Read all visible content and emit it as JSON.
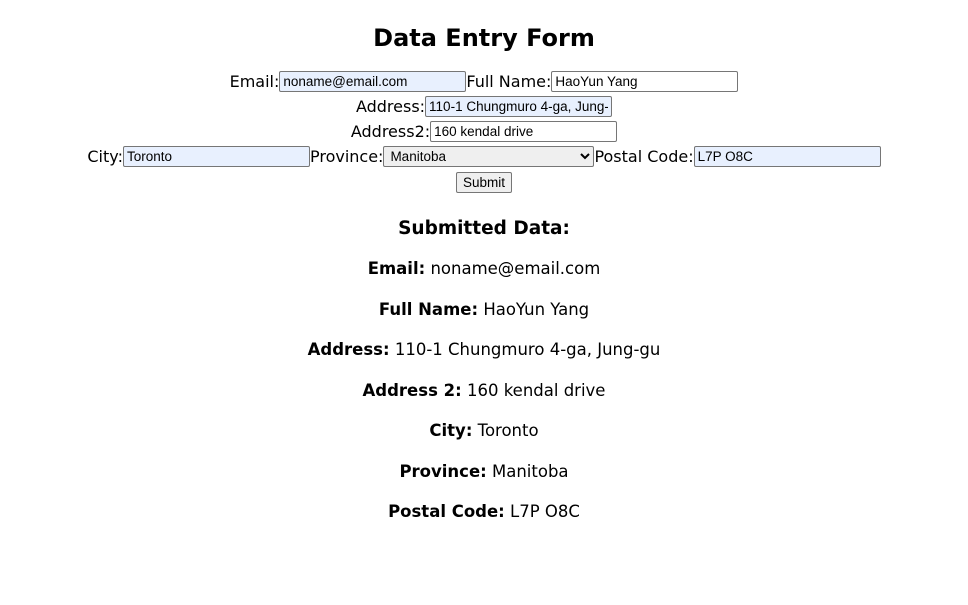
{
  "form": {
    "title": "Data Entry Form",
    "email_label": "Email:",
    "email_value": "noname@email.com",
    "fullname_label": "Full Name:",
    "fullname_value": "HaoYun Yang",
    "address_label": "Address:",
    "address_value": "110-1 Chungmuro 4-ga, Jung-gu",
    "address2_label": "Address2:",
    "address2_value": "160 kendal drive",
    "city_label": "City:",
    "city_value": "Toronto",
    "province_label": "Province:",
    "province_value": "Manitoba",
    "postal_label": "Postal Code:",
    "postal_value": "L7P O8C",
    "submit_label": "Submit"
  },
  "submitted": {
    "title": "Submitted Data:",
    "rows": [
      {
        "label": "Email:",
        "value": "noname@email.com"
      },
      {
        "label": "Full Name:",
        "value": "HaoYun Yang"
      },
      {
        "label": "Address:",
        "value": "110-1 Chungmuro 4-ga, Jung-gu"
      },
      {
        "label": "Address 2:",
        "value": "160 kendal drive"
      },
      {
        "label": "City:",
        "value": "Toronto"
      },
      {
        "label": "Province:",
        "value": "Manitoba"
      },
      {
        "label": "Postal Code:",
        "value": "L7P O8C"
      }
    ]
  }
}
